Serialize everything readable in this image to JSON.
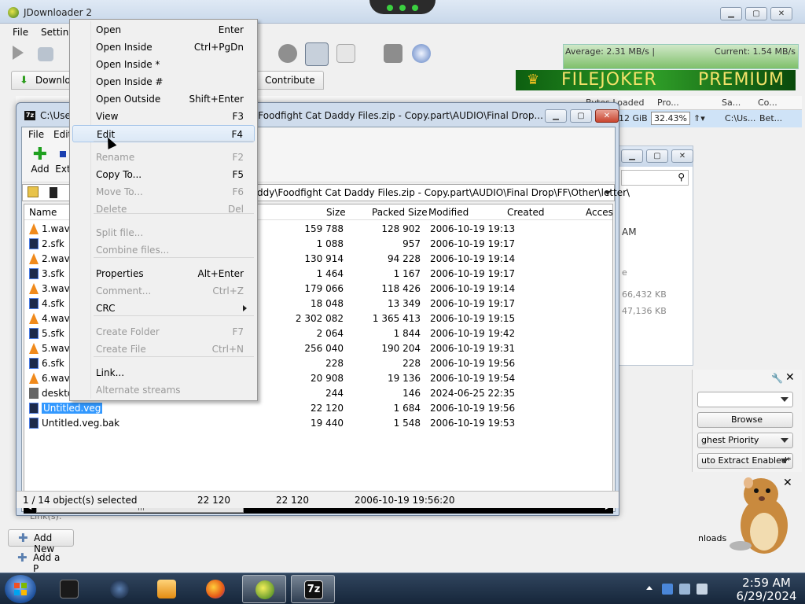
{
  "jdownloader": {
    "title": "JDownloader 2",
    "menu": [
      "File",
      "Setting"
    ],
    "speed_average": "Average: 2.31 MB/s |",
    "speed_current": "Current: 1.54 MB/s",
    "tabs": [
      "Downloa",
      "Contribute"
    ],
    "banner_left": "FILEJOKER",
    "banner_right": "PREMIUM",
    "columns": [
      "Bytes Loaded",
      "Pro...",
      "Sa...",
      "Co..."
    ],
    "row": {
      "loaded": "12 GiB",
      "progress": "32.43%",
      "save": "C:\\Us...",
      "comment": "Bet..."
    },
    "right_panel": {
      "time": "AM",
      "letter": "e",
      "size1": "66,432 KB",
      "size2": "47,136 KB"
    },
    "settings": {
      "browse": "Browse",
      "priority": "ghest Priority",
      "extract": "uto Extract Enabled*"
    },
    "bottom": {
      "add_new": "Add New",
      "add_p": "Add a P",
      "links": "Link(s):",
      "downloads": "nloads"
    }
  },
  "sevenzip": {
    "title": "C:\\Use",
    "title_tail": "ddy\\Foodfight Cat Daddy Files.zip - Copy.part\\AUDIO\\Final Drop...",
    "menu": [
      "File",
      "Edit"
    ],
    "tools": [
      "Add",
      "Ext"
    ],
    "address": "ddy\\Foodfight Cat Daddy Files.zip - Copy.part\\AUDIO\\Final Drop\\FF\\Other\\letter\\",
    "columns": {
      "name": "Name",
      "size": "Size",
      "packed": "Packed Size",
      "modified": "Modified",
      "created": "Created",
      "access": "Acces"
    },
    "files": [
      {
        "name": "1.wav",
        "type": "wav",
        "size": "159 788",
        "packed": "128 902",
        "modified": "2006-10-19 19:13"
      },
      {
        "name": "2.sfk",
        "type": "sfk",
        "size": "1 088",
        "packed": "957",
        "modified": "2006-10-19 19:17"
      },
      {
        "name": "2.wav",
        "type": "wav",
        "size": "130 914",
        "packed": "94 228",
        "modified": "2006-10-19 19:14"
      },
      {
        "name": "3.sfk",
        "type": "sfk",
        "size": "1 464",
        "packed": "1 167",
        "modified": "2006-10-19 19:17"
      },
      {
        "name": "3.wav",
        "type": "wav",
        "size": "179 066",
        "packed": "118 426",
        "modified": "2006-10-19 19:14"
      },
      {
        "name": "4.sfk",
        "type": "sfk",
        "size": "18 048",
        "packed": "13 349",
        "modified": "2006-10-19 19:17"
      },
      {
        "name": "4.wav",
        "type": "wav",
        "size": "2 302 082",
        "packed": "1 365 413",
        "modified": "2006-10-19 19:15"
      },
      {
        "name": "5.sfk",
        "type": "sfk",
        "size": "2 064",
        "packed": "1 844",
        "modified": "2006-10-19 19:42"
      },
      {
        "name": "5.wav",
        "type": "wav",
        "size": "256 040",
        "packed": "190 204",
        "modified": "2006-10-19 19:31"
      },
      {
        "name": "6.sfk",
        "type": "sfk",
        "size": "228",
        "packed": "228",
        "modified": "2006-10-19 19:56"
      },
      {
        "name": "6.wav",
        "type": "wav",
        "size": "20 908",
        "packed": "19 136",
        "modified": "2006-10-19 19:54"
      },
      {
        "name": "deskto",
        "type": "ini",
        "size": "244",
        "packed": "146",
        "modified": "2024-06-25 22:35"
      },
      {
        "name": "Untitled.veg",
        "type": "veg",
        "size": "22 120",
        "packed": "1 684",
        "modified": "2006-10-19 19:56",
        "selected": true
      },
      {
        "name": "Untitled.veg.bak",
        "type": "veg",
        "size": "19 440",
        "packed": "1 548",
        "modified": "2006-10-19 19:53"
      }
    ],
    "status": {
      "selection": "1 / 14 object(s) selected",
      "size": "22 120",
      "packed": "22 120",
      "modified": "2006-10-19 19:56:20"
    }
  },
  "context_menu": {
    "items": [
      {
        "label": "Open",
        "shortcut": "Enter",
        "enabled": true
      },
      {
        "label": "Open Inside",
        "shortcut": "Ctrl+PgDn",
        "enabled": true
      },
      {
        "label": "Open Inside *",
        "shortcut": "",
        "enabled": true
      },
      {
        "label": "Open Inside #",
        "shortcut": "",
        "enabled": true
      },
      {
        "label": "Open Outside",
        "shortcut": "Shift+Enter",
        "enabled": true
      },
      {
        "label": "View",
        "shortcut": "F3",
        "enabled": true
      },
      {
        "label": "Edit",
        "shortcut": "F4",
        "enabled": true,
        "hovered": true
      },
      {
        "label": "Rename",
        "shortcut": "F2",
        "enabled": false
      },
      {
        "label": "Copy To...",
        "shortcut": "F5",
        "enabled": true
      },
      {
        "label": "Move To...",
        "shortcut": "F6",
        "enabled": false
      },
      {
        "label": "Delete",
        "shortcut": "Del",
        "enabled": false
      },
      {
        "label": "Split file...",
        "shortcut": "",
        "enabled": false
      },
      {
        "label": "Combine files...",
        "shortcut": "",
        "enabled": false
      },
      {
        "label": "Properties",
        "shortcut": "Alt+Enter",
        "enabled": true
      },
      {
        "label": "Comment...",
        "shortcut": "Ctrl+Z",
        "enabled": false
      },
      {
        "label": "CRC",
        "shortcut": "",
        "enabled": true,
        "submenu": true
      },
      {
        "label": "Create Folder",
        "shortcut": "F7",
        "enabled": false
      },
      {
        "label": "Create File",
        "shortcut": "Ctrl+N",
        "enabled": false
      },
      {
        "label": "Link...",
        "shortcut": "",
        "enabled": true
      },
      {
        "label": "Alternate streams",
        "shortcut": "",
        "enabled": false
      }
    ]
  },
  "taskbar": {
    "apps": [
      "cube-app-icon",
      "steam-icon",
      "media-player-icon",
      "firefox-icon",
      "jdownloader-icon",
      "7zip-icon"
    ],
    "active_app": "jdownloader-icon",
    "sevenzip_label": "7z",
    "time": "2:59 AM",
    "date": "6/29/2024"
  }
}
